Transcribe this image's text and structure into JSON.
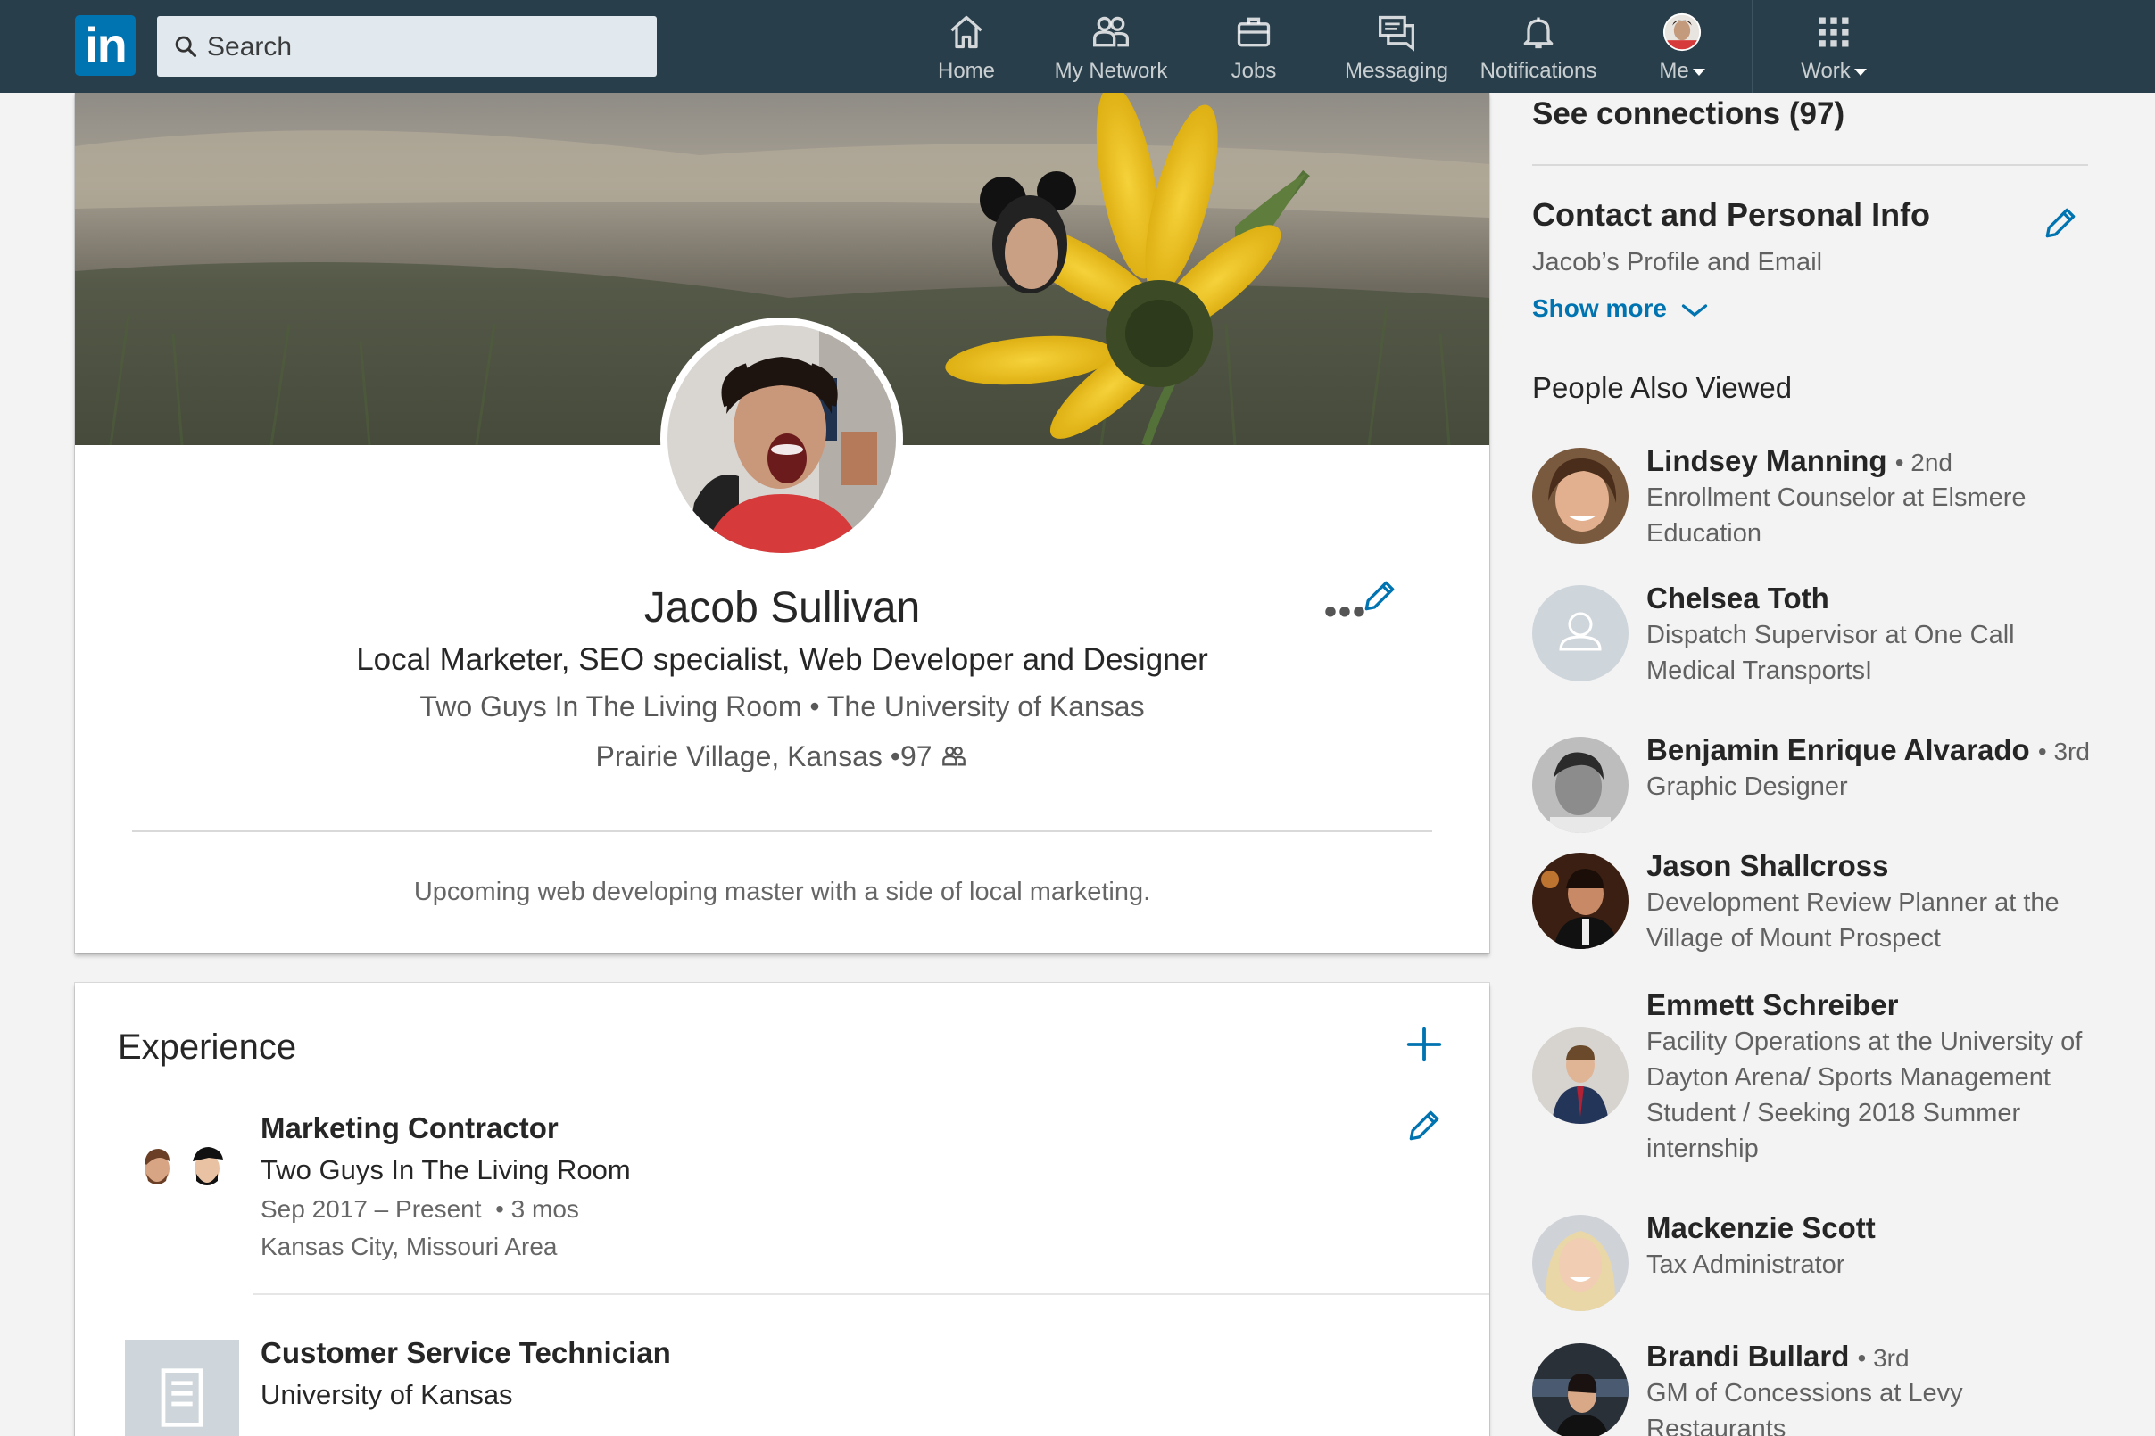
{
  "nav": {
    "search_placeholder": "Search",
    "items": [
      {
        "label": "Home",
        "icon": "home-icon"
      },
      {
        "label": "My Network",
        "icon": "network-icon"
      },
      {
        "label": "Jobs",
        "icon": "briefcase-icon"
      },
      {
        "label": "Messaging",
        "icon": "messaging-icon"
      },
      {
        "label": "Notifications",
        "icon": "bell-icon"
      },
      {
        "label": "Me",
        "icon": "avatar"
      },
      {
        "label": "Work",
        "icon": "grid-icon"
      }
    ],
    "logo_text": "in"
  },
  "profile": {
    "name": "Jacob Sullivan",
    "headline": "Local Marketer, SEO specialist, Web Developer and Designer",
    "company": "Two Guys In The Living Room",
    "school": "The University of Kansas",
    "location": "Prairie Village, Kansas",
    "connections": "97",
    "summary": "Upcoming web developing master with a side of local marketing.",
    "more_label": "•••"
  },
  "experience": {
    "title": "Experience",
    "jobs": [
      {
        "title": "Marketing Contractor",
        "company": "Two Guys In The Living Room",
        "dates": "Sep 2017 – Present",
        "duration": "3 mos",
        "location": "Kansas City, Missouri Area"
      },
      {
        "title": "Customer Service Technician",
        "company": "University of Kansas"
      }
    ]
  },
  "sidebar": {
    "see_connections": "See connections (97)",
    "contact_title": "Contact and Personal Info",
    "contact_sub": "Jacob’s Profile and Email",
    "show_more": "Show more",
    "pav_title": "People Also Viewed",
    "people": [
      {
        "name": "Lindsey Manning",
        "degree": "• 2nd",
        "title": "Enrollment Counselor at Elsmere Education"
      },
      {
        "name": "Chelsea Toth",
        "degree": "",
        "title": "Dispatch Supervisor at One Call Medical TransportsI"
      },
      {
        "name": "Benjamin Enrique Alvarado",
        "degree": "• 3rd",
        "title": "Graphic Designer"
      },
      {
        "name": "Jason Shallcross",
        "degree": "",
        "title": "Development Review Planner at the Village of Mount Prospect"
      },
      {
        "name": "Emmett Schreiber",
        "degree": "",
        "title": "Facility Operations at the University of Dayton Arena/ Sports Management Student / Seeking 2018 Summer internship"
      },
      {
        "name": "Mackenzie Scott",
        "degree": "",
        "title": "Tax Administrator"
      },
      {
        "name": "Brandi Bullard",
        "degree": "• 3rd",
        "title": "GM of Concessions at Levy Restaurants"
      }
    ]
  },
  "colors": {
    "nav_bg": "#283e4a",
    "accent": "#0073b1",
    "page_bg": "#f3f3f3"
  }
}
